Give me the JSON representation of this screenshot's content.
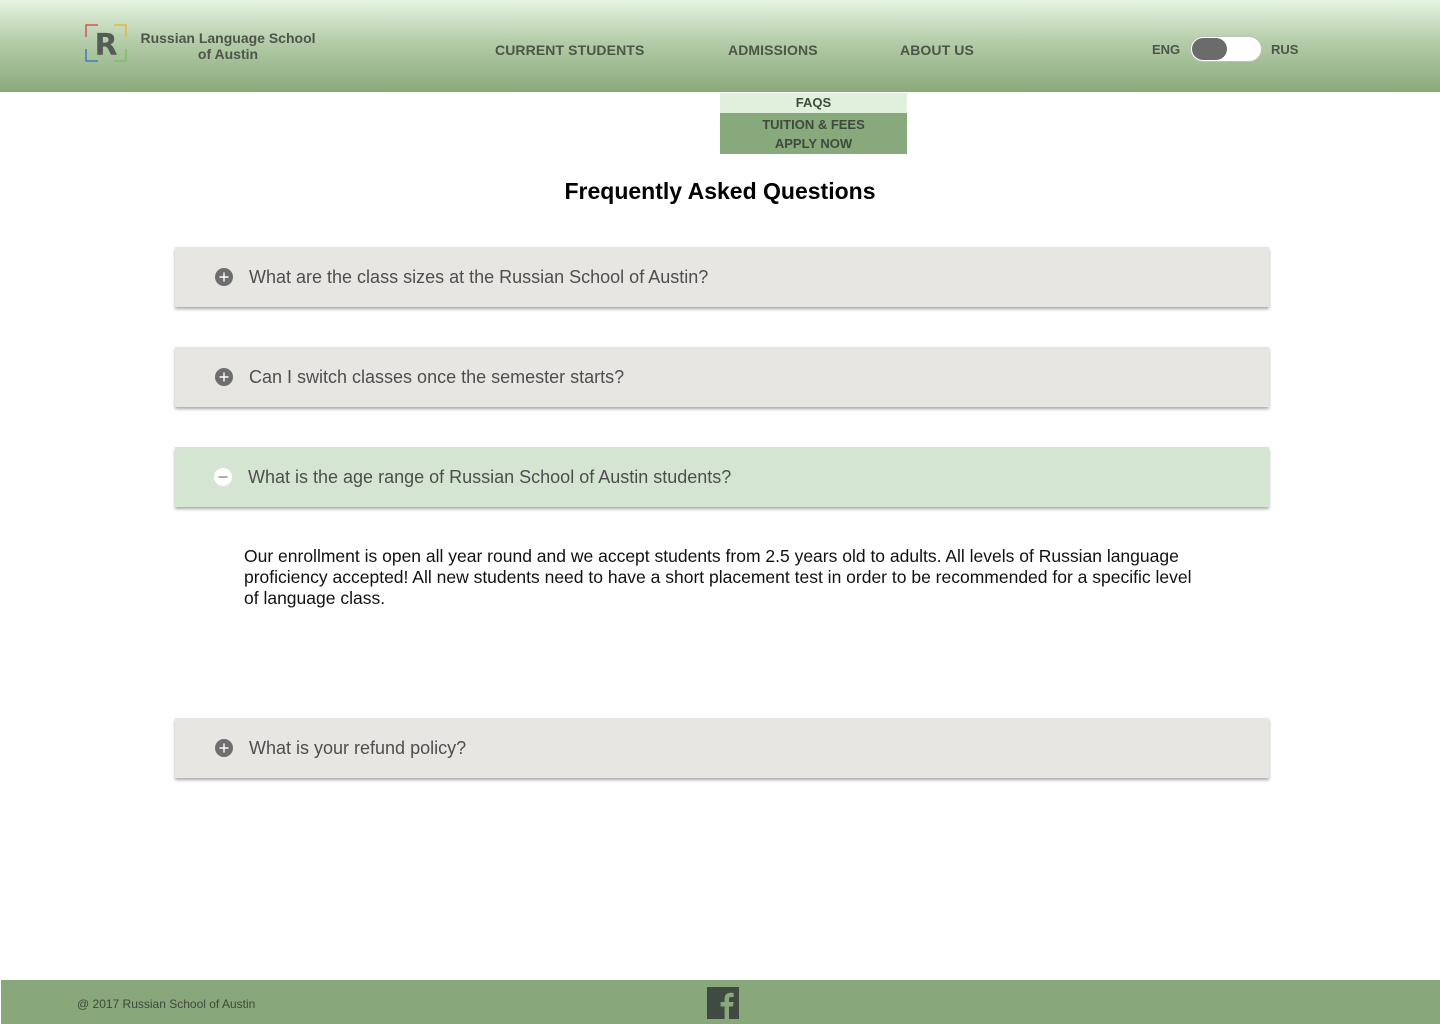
{
  "header": {
    "logo_letter": "R",
    "school_name_line1": "Russian Language School",
    "school_name_line2": "of Austin",
    "nav": {
      "current_students": "CURRENT STUDENTS",
      "admissions": "ADMISSIONS",
      "about_us": "ABOUT US"
    },
    "lang": {
      "eng": "ENG",
      "rus": "RUS",
      "selected": "ENG"
    }
  },
  "dropdown": {
    "items": [
      "FAQS",
      "TUITION & FEES",
      "APPLY NOW"
    ],
    "active": "FAQS"
  },
  "page_title": "Frequently Asked Questions",
  "faq": [
    {
      "question": "What are the class sizes at the Russian School of Austin?",
      "expanded": false,
      "icon": "plus-circle-icon"
    },
    {
      "question": "Can I switch classes once the semester starts?",
      "expanded": false,
      "icon": "plus-circle-icon"
    },
    {
      "question": "What is the age range of Russian School of Austin students?",
      "expanded": true,
      "icon": "minus-circle-icon",
      "answer": "Our enrollment is open all year round and we accept students from 2.5 years old to adults. All levels of Russian language proficiency accepted! All new students need to have a short placement test in order to be recommended for a specific level of language class."
    },
    {
      "question": "What is your refund policy?",
      "expanded": false,
      "icon": "plus-circle-icon"
    }
  ],
  "footer": {
    "copyright": "@ 2017 Russian School of Austin",
    "social_icon": "facebook-icon"
  },
  "colors": {
    "header_green": "#8aa97b",
    "dropdown_green": "#88a97c",
    "active_faq_bg": "#d4e6d1",
    "faq_bg": "#e8e6e2",
    "footer_green": "#88a77a"
  }
}
